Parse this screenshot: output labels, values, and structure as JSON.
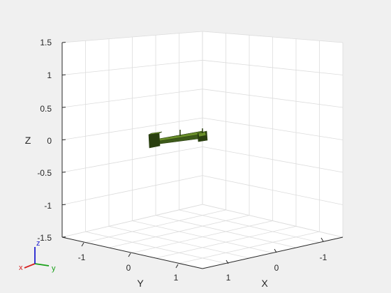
{
  "figure": {
    "background": "#f0f0f0",
    "plot_background": "#ffffff"
  },
  "axes": {
    "z": {
      "label": "Z",
      "ticks": [
        "1.5",
        "1",
        "0.5",
        "0",
        "-0.5",
        "-1",
        "-1.5"
      ],
      "range": [
        -1.5,
        1.5
      ]
    },
    "y": {
      "label": "Y",
      "ticks": [
        "-1",
        "0",
        "1"
      ],
      "range": [
        -1.5,
        1.5
      ]
    },
    "x": {
      "label": "X",
      "ticks": [
        "1",
        "0",
        "-1"
      ],
      "range": [
        -1.5,
        1.5
      ]
    },
    "grid": true,
    "grid_color": "#dcdcdc",
    "axis_color": "#262626"
  },
  "robot_model": {
    "color": "#3d5a1a",
    "highlight": "#6a8f2a",
    "shadow": "#2a3f10",
    "icon": "robot-arm-mesh"
  },
  "coordinate_triad": {
    "x_label": "x",
    "y_label": "y",
    "z_label": "z",
    "x_color": "#d62020",
    "y_color": "#18a018",
    "z_color": "#2020d0"
  }
}
